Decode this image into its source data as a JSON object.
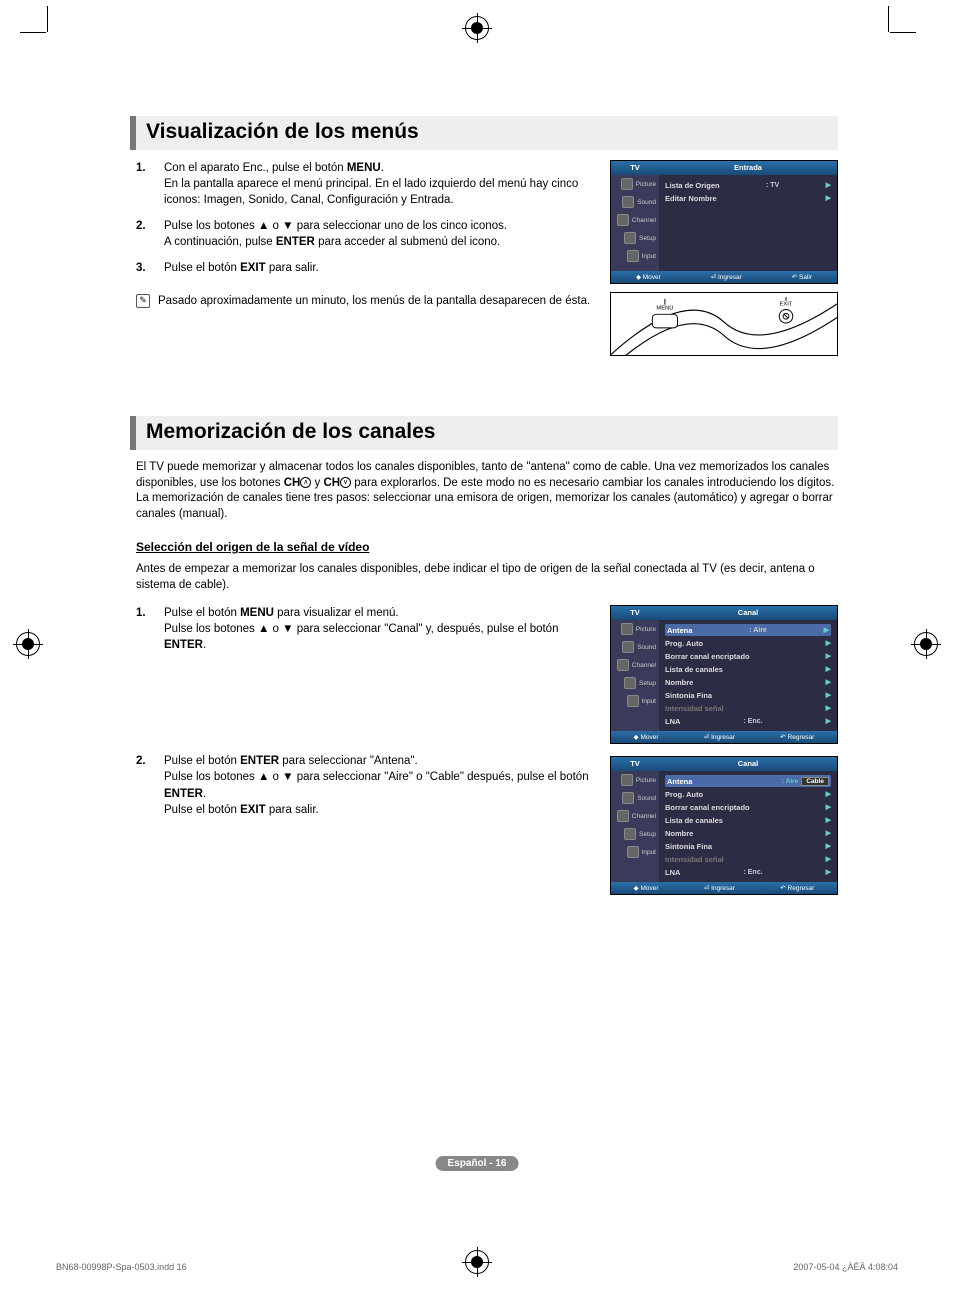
{
  "section1": {
    "title": "Visualización de los menús",
    "steps": [
      {
        "num": "1.",
        "html": "Con el aparato Enc., pulse el botón <b>MENU</b>.<br>En la pantalla aparece el menú principal. En el lado izquierdo del menú hay cinco iconos: Imagen, Sonido, Canal, Configuración y Entrada."
      },
      {
        "num": "2.",
        "html": "Pulse los botones ▲ o ▼ para seleccionar uno de los cinco iconos.<br>A continuación, pulse <b>ENTER</b> para acceder al submenú del icono."
      },
      {
        "num": "3.",
        "html": "Pulse el botón <b>EXIT</b> para salir."
      }
    ],
    "note": "Pasado aproximadamente un minuto, los menús de la pantalla desaparecen de ésta."
  },
  "section2": {
    "title": "Memorización de los canales",
    "intro_html": "El TV puede memorizar y almacenar todos los canales disponibles, tanto de \"antena\" como de cable. Una vez memorizados los canales disponibles, use los botones <b>CH</b><span class='ch-btn'>∧</span> y <b>CH</b><span class='ch-btn'>∨</span> para explorarlos. De este modo no es necesario cambiar los canales introduciendo los dígitos. La memorización de canales tiene tres pasos: seleccionar una emisora de origen, memorizar los canales (automático) y agregar o borrar canales (manual).",
    "sub_heading": "Selección del origen de la señal de vídeo",
    "sub_intro": "Antes de empezar a memorizar los canales disponibles, debe indicar el tipo de origen de la señal conectada al TV (es decir, antena o sistema de cable).",
    "steps": [
      {
        "num": "1.",
        "html": "Pulse el botón <b>MENU</b> para visualizar el menú.<br>Pulse los botones ▲ o ▼ para seleccionar \"Canal\" y, después, pulse el botón <b>ENTER</b>."
      },
      {
        "num": "2.",
        "html": "Pulse el botón <b>ENTER</b> para seleccionar \"Antena\".<br>Pulse los botones ▲ o ▼ para seleccionar \"Aire\" o \"Cable\" después, pulse el botón <b>ENTER</b>.<br>Pulse el botón <b>EXIT</b> para salir."
      }
    ]
  },
  "menus": {
    "tv_label": "TV",
    "side_items": [
      "Picture",
      "Sound",
      "Channel",
      "Setup",
      "Input"
    ],
    "footer": {
      "mover": "Mover",
      "ingresar": "Ingresar",
      "salir": "Salir",
      "regresar": "Regresar"
    },
    "menu1": {
      "section": "Entrada",
      "rows": [
        {
          "label": "Lista de Origen",
          "value": ": TV"
        },
        {
          "label": "Editar Nombre",
          "value": ""
        }
      ]
    },
    "menu2": {
      "section": "Canal",
      "rows": [
        {
          "label": "Antena",
          "value": ": Aire",
          "hl": true
        },
        {
          "label": "Prog. Auto"
        },
        {
          "label": "Borrar canal encriptado"
        },
        {
          "label": "Lista de canales"
        },
        {
          "label": "Nombre"
        },
        {
          "label": "Sintonia Fina"
        },
        {
          "label": "Intensidad señal",
          "dim": true
        },
        {
          "label": "LNA",
          "value": ": Enc."
        }
      ]
    },
    "menu3": {
      "section": "Canal",
      "rows": [
        {
          "label": "Antena",
          "opt": [
            "Aire",
            "Cable"
          ],
          "hl": true
        },
        {
          "label": "Prog. Auto"
        },
        {
          "label": "Borrar canal encriptado"
        },
        {
          "label": "Lista de canales"
        },
        {
          "label": "Nombre"
        },
        {
          "label": "Sintonia Fina"
        },
        {
          "label": "Intensidad señal",
          "dim": true
        },
        {
          "label": "LNA",
          "value": ": Enc."
        }
      ]
    }
  },
  "remote": {
    "menu": "MENU",
    "exit": "EXIT"
  },
  "page_label": "Español - 16",
  "footer_left": "BN68-00998P-Spa-0503.indd   16",
  "footer_right": "2007-05-04   ¿ÀÈÄ 4:08:04"
}
